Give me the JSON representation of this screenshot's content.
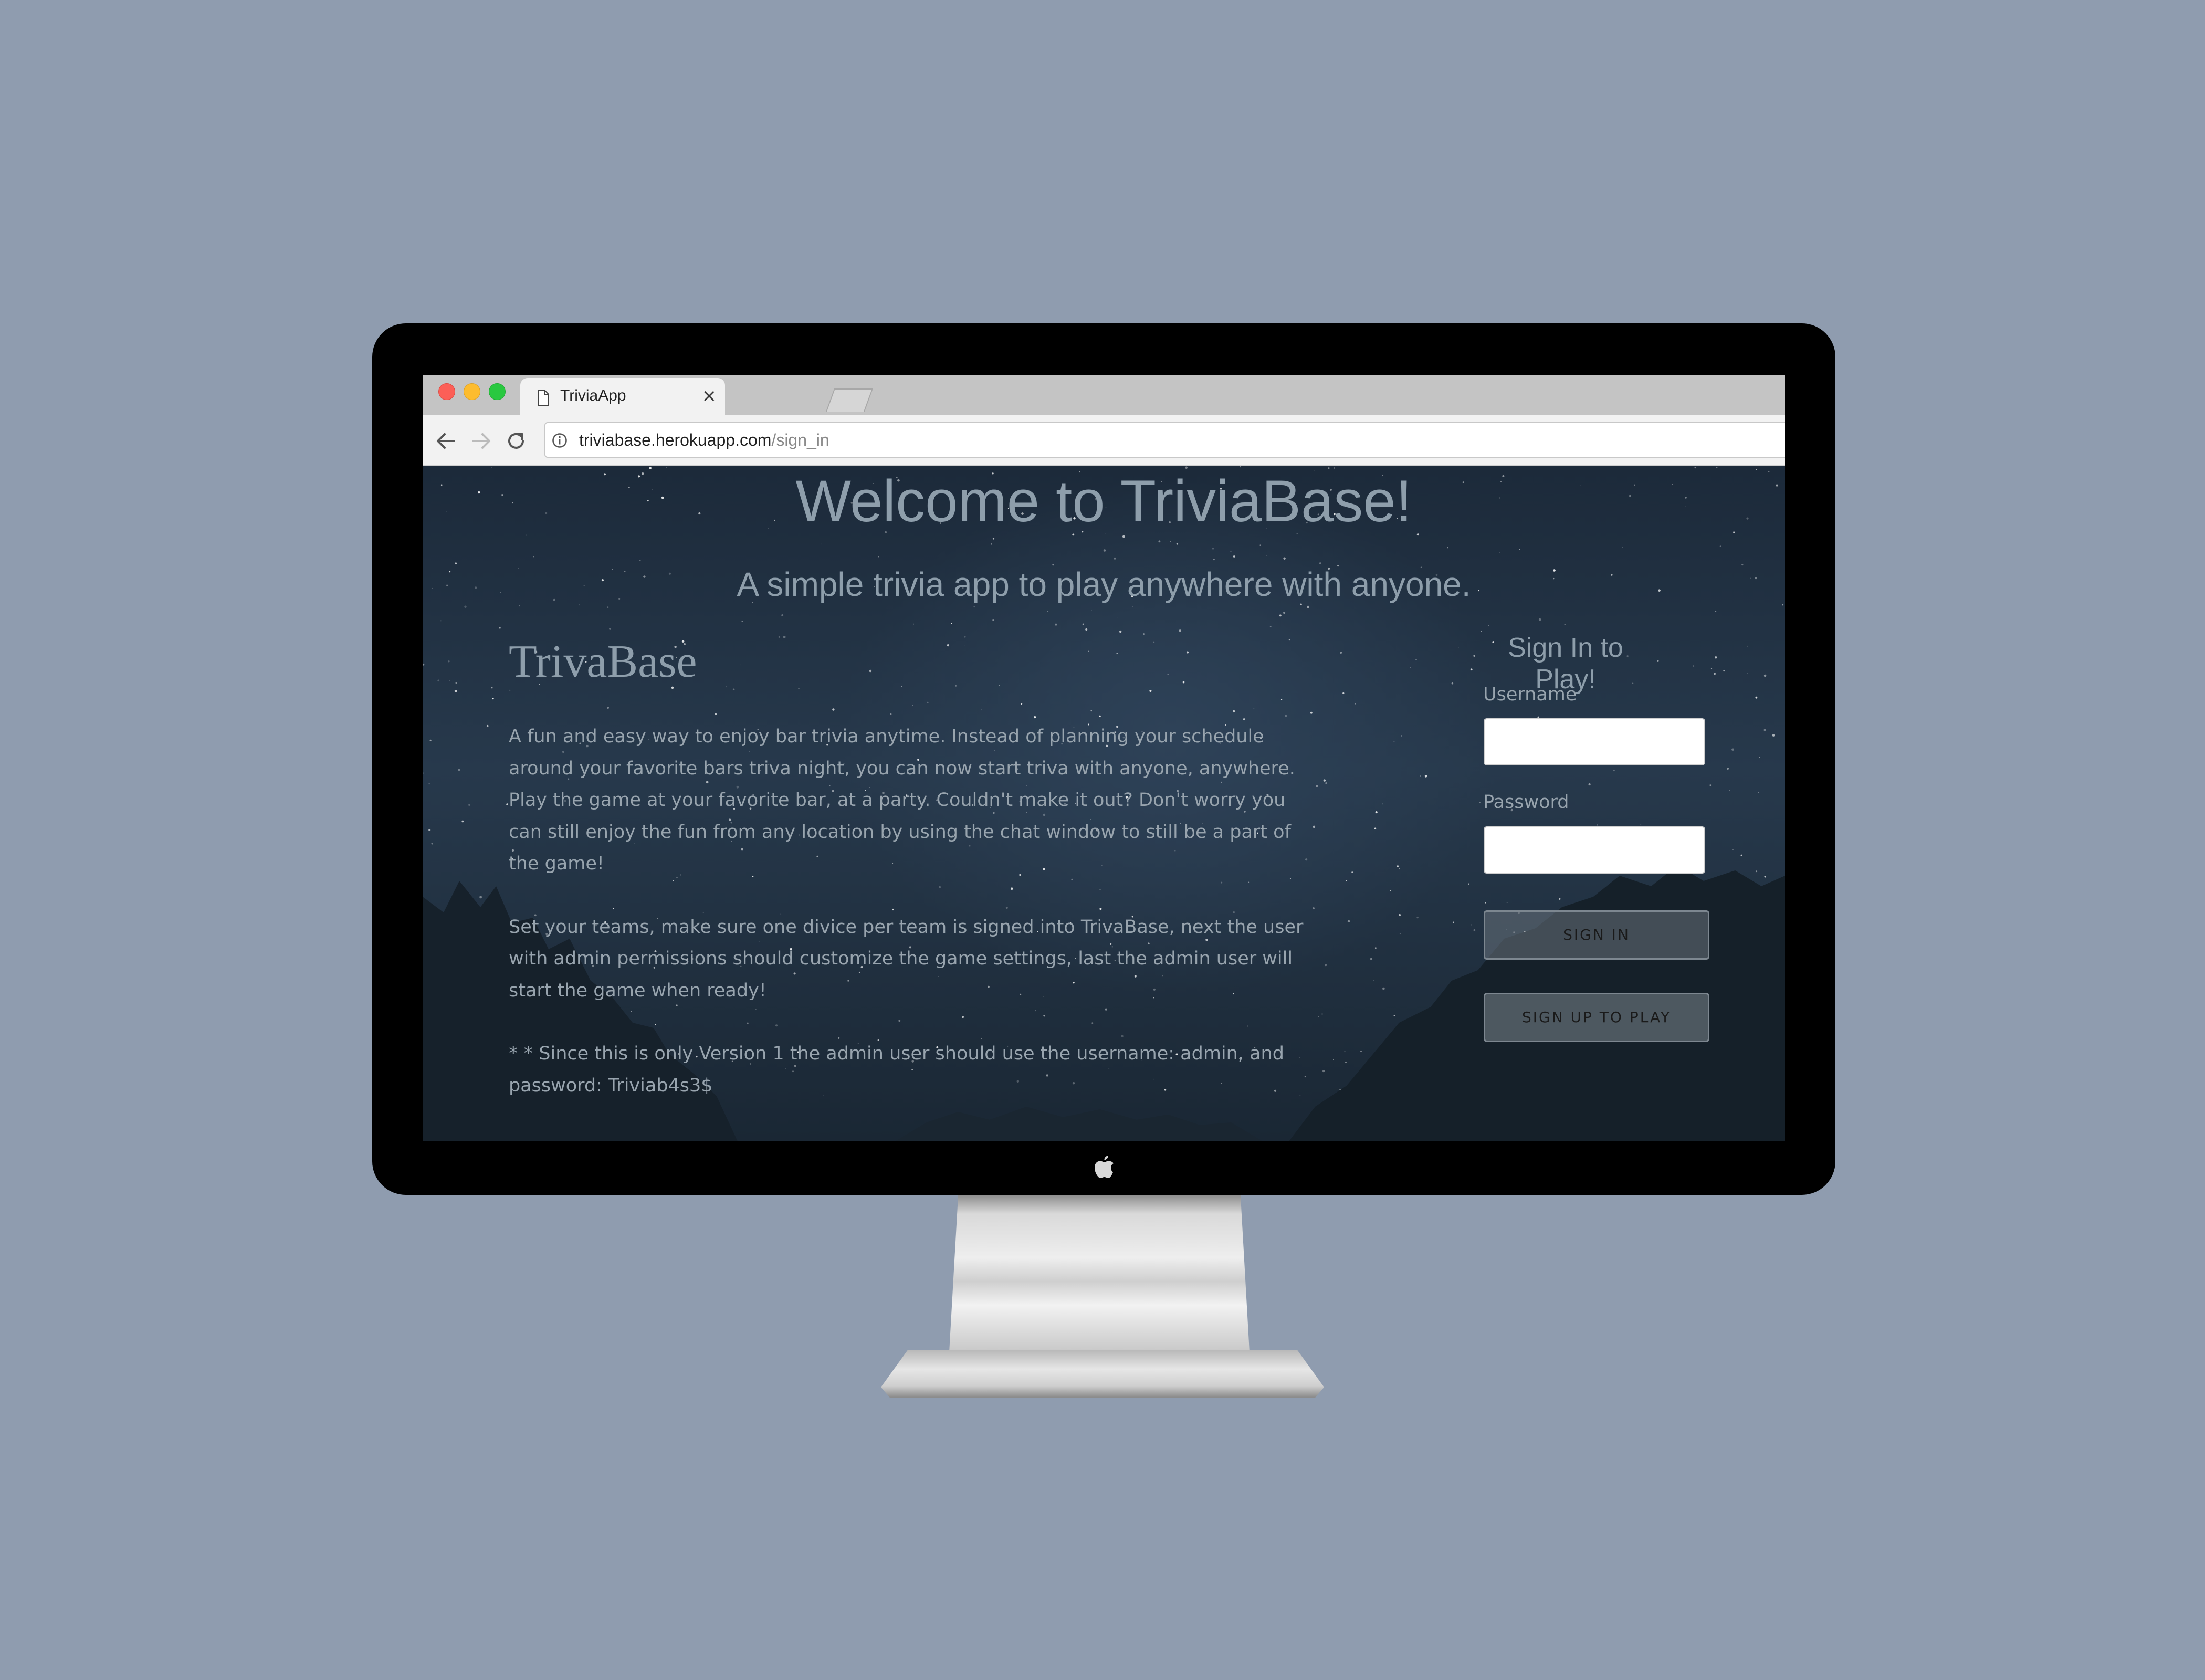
{
  "browser": {
    "tab_title": "TriviaApp",
    "tab_close": "×",
    "url_host": "triviabase.herokuapp.com",
    "url_path": "/sign_in"
  },
  "page": {
    "heading": "Welcome to TriviaBase!",
    "subheading": "A simple trivia app to play anywhere with anyone.",
    "brand": "TrivaBase",
    "paragraphs": [
      "A fun and easy way to enjoy bar trivia anytime. Instead of planning your schedule around your favorite bars triva night, you can now start triva with anyone, anywhere. Play the game at your favorite bar, at a party. Couldn't make it out? Don't worry you can still enjoy the fun from any location by using the chat window to still be a part of the game!",
      "Set your teams, make sure one divice per team is signed into TrivaBase, next the user with admin permissions should customize the game settings, last the admin user will start the game when ready!",
      "* * Since this is only Version 1 the admin user should use the username: admin, and password: Triviab4s3$"
    ]
  },
  "signin": {
    "title": "Sign In to Play!",
    "username_label": "Username",
    "username_value": "",
    "password_label": "Password",
    "password_value": "",
    "signin_button": "SIGN IN",
    "signup_button": "SIGN UP TO PLAY"
  },
  "colors": {
    "background": "#8f9caf",
    "page_text": "#8e9eab",
    "night_sky": "#1b2835"
  }
}
